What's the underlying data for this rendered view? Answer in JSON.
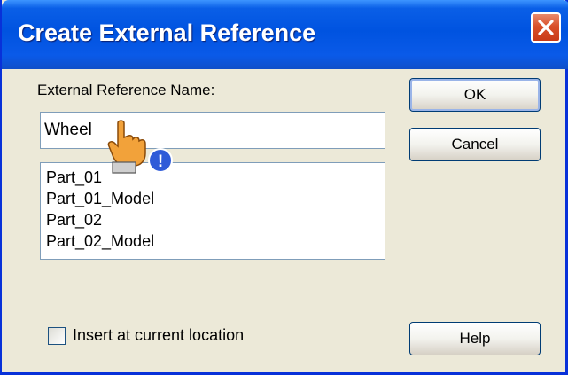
{
  "window": {
    "title": "Create External Reference",
    "close_icon": "close-icon"
  },
  "form": {
    "name_label": "External Reference Name:",
    "name_value": "Wheel"
  },
  "list": {
    "items": [
      "Part_01",
      "Part_01_Model",
      "Part_02",
      "Part_02_Model"
    ]
  },
  "buttons": {
    "ok": "OK",
    "cancel": "Cancel",
    "help": "Help"
  },
  "options": {
    "insert_label": "Insert at current location",
    "insert_checked": false
  },
  "overlay": {
    "cursor_icon": "hand-pointer-warning-icon",
    "badge_text": "!"
  },
  "colors": {
    "titlebar": "#0053e0",
    "dialog_bg": "#ece9d8",
    "close_button": "#d9502a",
    "input_border": "#7f9db9"
  }
}
